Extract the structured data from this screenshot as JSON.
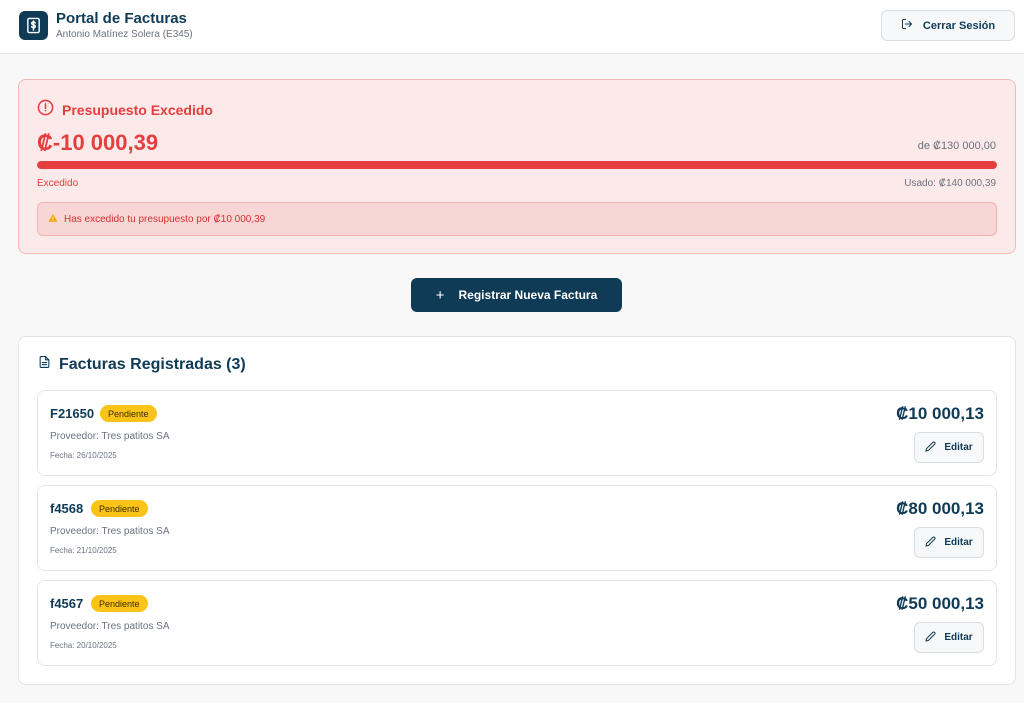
{
  "header": {
    "title": "Portal de Facturas",
    "user": "Antonio Matínez Solera (E345)",
    "logout_label": "Cerrar Sesión"
  },
  "budget": {
    "title": "Presupuesto Excedido",
    "amount": "₡-10 000,39",
    "total": "de ₡130 000,00",
    "progress": 1.0,
    "status": "Excedido",
    "used": "Usado: ₡140 000,39",
    "warning": "Has excedido tu presupuesto por ₡10 000,39"
  },
  "actions": {
    "new_invoice_label": "Registrar Nueva Factura"
  },
  "invoices": {
    "title": "Facturas Registradas (3)",
    "items": [
      {
        "number": "F21650",
        "status": "Pendiente",
        "provider": "Proveedor: Tres patitos SA",
        "date": "Fecha: 26/10/2025",
        "amount": "₡10 000,13",
        "edit_label": "Editar"
      },
      {
        "number": "f4568",
        "status": "Pendiente",
        "provider": "Proveedor: Tres patitos SA",
        "date": "Fecha: 21/10/2025",
        "amount": "₡80 000,13",
        "edit_label": "Editar"
      },
      {
        "number": "f4567",
        "status": "Pendiente",
        "provider": "Proveedor: Tres patitos SA",
        "date": "Fecha: 20/10/2025",
        "amount": "₡50 000,13",
        "edit_label": "Editar"
      }
    ]
  },
  "colors": {
    "primary": "#0f3b57",
    "danger": "#e53e3e",
    "warning_badge": "#fcc419"
  }
}
